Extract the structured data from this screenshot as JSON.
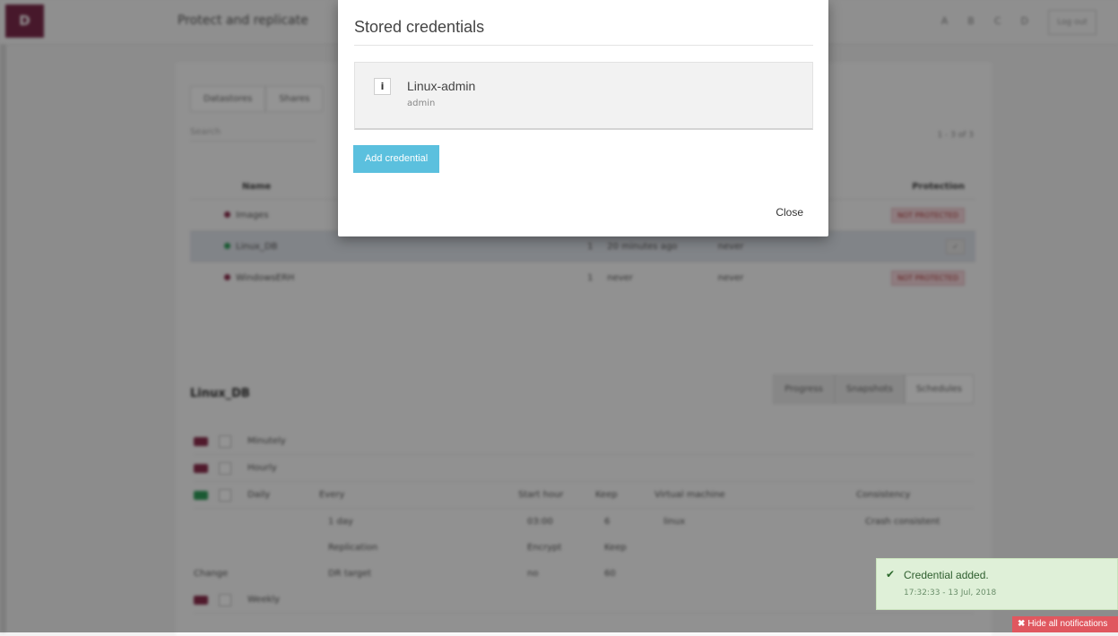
{
  "header": {
    "logo_text": "D",
    "page_title": "Protect and replicate",
    "icons": [
      "A",
      "B",
      "C",
      "D"
    ],
    "login_label": "Log out"
  },
  "vms": {
    "tabs": [
      "Datastores",
      "Shares"
    ],
    "search_placeholder": "Search",
    "count": "1 - 3 of 3",
    "headers": {
      "name": "Name",
      "protection": "Protection"
    },
    "rows": [
      {
        "name": "Images",
        "n": "",
        "last": "",
        "next": "",
        "protection": "NOT PROTECTED",
        "status": "bad"
      },
      {
        "name": "Linux_DB",
        "n": "1",
        "last": "20 minutes ago",
        "next": "never",
        "protection": "✓",
        "status": "ok"
      },
      {
        "name": "WindowsERH",
        "n": "1",
        "last": "never",
        "next": "never",
        "protection": "NOT PROTECTED",
        "status": "bad"
      }
    ]
  },
  "detail": {
    "title": "Linux_DB",
    "tabs": [
      "Progress",
      "Snapshots",
      "Schedules"
    ],
    "schedules": [
      "Minutely",
      "Hourly",
      "Daily"
    ],
    "grid": {
      "headers1": [
        "Every",
        "Start hour",
        "Keep",
        "Virtual machine",
        "Consistency"
      ],
      "values1": [
        "1 day",
        "03:00",
        "6",
        "linux",
        "Crash consistent"
      ],
      "headers2": [
        "Replication",
        "Encrypt",
        "Keep"
      ],
      "values2": [
        "DR target",
        "no",
        "60"
      ],
      "change_label": "Change"
    },
    "extra_schedule": "Weekly"
  },
  "modal": {
    "title": "Stored credentials",
    "credential": {
      "info_icon": "i",
      "name": "Linux-admin",
      "user": "admin"
    },
    "add_label": "Add credential",
    "close_label": "Close"
  },
  "notification": {
    "text": "Credential added.",
    "time": "17:32:33 - 13 Jul, 2018",
    "hide_all_label": "Hide all notifications"
  },
  "colors": {
    "logo": "#7b2a4a",
    "add_button": "#5bc0de",
    "notify_bg": "#dff0d8",
    "hide_all_bg": "#e0575f"
  }
}
